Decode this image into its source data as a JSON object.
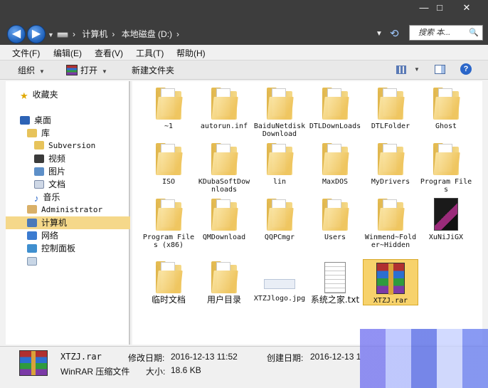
{
  "window": {
    "minimize": "—",
    "maximize": "□",
    "close": "✕"
  },
  "address": {
    "back": "◀",
    "forward": "▶",
    "crumbs": [
      "计算机",
      "本地磁盘 (D:)"
    ],
    "search_placeholder": "搜索 本...",
    "search_icon": "🔍"
  },
  "menu": [
    "文件(F)",
    "编辑(E)",
    "查看(V)",
    "工具(T)",
    "帮助(H)"
  ],
  "toolbar": {
    "organize": "组织",
    "open": "打开",
    "new_folder": "新建文件夹",
    "help": "?"
  },
  "nav": {
    "favorites": "收藏夹",
    "desktop": "桌面",
    "library": "库",
    "subversion": "Subversion",
    "video": "视频",
    "pictures": "图片",
    "documents": "文档",
    "music": "音乐",
    "administrator": "Administrator",
    "computer": "计算机",
    "network": "网络",
    "control_panel": "控制面板"
  },
  "files": [
    {
      "name": "~1"
    },
    {
      "name": "autorun.inf"
    },
    {
      "name": "BaiduNetdiskDownload"
    },
    {
      "name": "DTLDownLoads"
    },
    {
      "name": "DTLFolder"
    },
    {
      "name": "Ghost"
    },
    {
      "name": "ISO"
    },
    {
      "name": "KDubaSoftDownloads"
    },
    {
      "name": "lin"
    },
    {
      "name": "MaxDOS"
    },
    {
      "name": "MyDrivers"
    },
    {
      "name": "Program Files"
    },
    {
      "name": "Program Files (x86)"
    },
    {
      "name": "QMDownload"
    },
    {
      "name": "QQPCmgr"
    },
    {
      "name": "Users"
    },
    {
      "name": "Winmend~Folder~Hidden"
    },
    {
      "name": "XuNiJiGX"
    },
    {
      "name": "临时文档"
    },
    {
      "name": "用户目录"
    },
    {
      "name": "XTZJlogo.jpg"
    },
    {
      "name": "系统之家.txt"
    },
    {
      "name": "XTZJ.rar"
    }
  ],
  "details": {
    "filename": "XTZJ.rar",
    "filetype": "WinRAR 压缩文件",
    "modified_label": "修改日期:",
    "modified_value": "2016-12-13 11:52",
    "created_label": "创建日期:",
    "created_value": "2016-12-13 1",
    "size_label": "大小:",
    "size_value": "18.6 KB"
  },
  "colors": {
    "selection": "#f7d26b",
    "titlebar": "#3d3d3d",
    "nav_selected": "#f5d88a"
  }
}
